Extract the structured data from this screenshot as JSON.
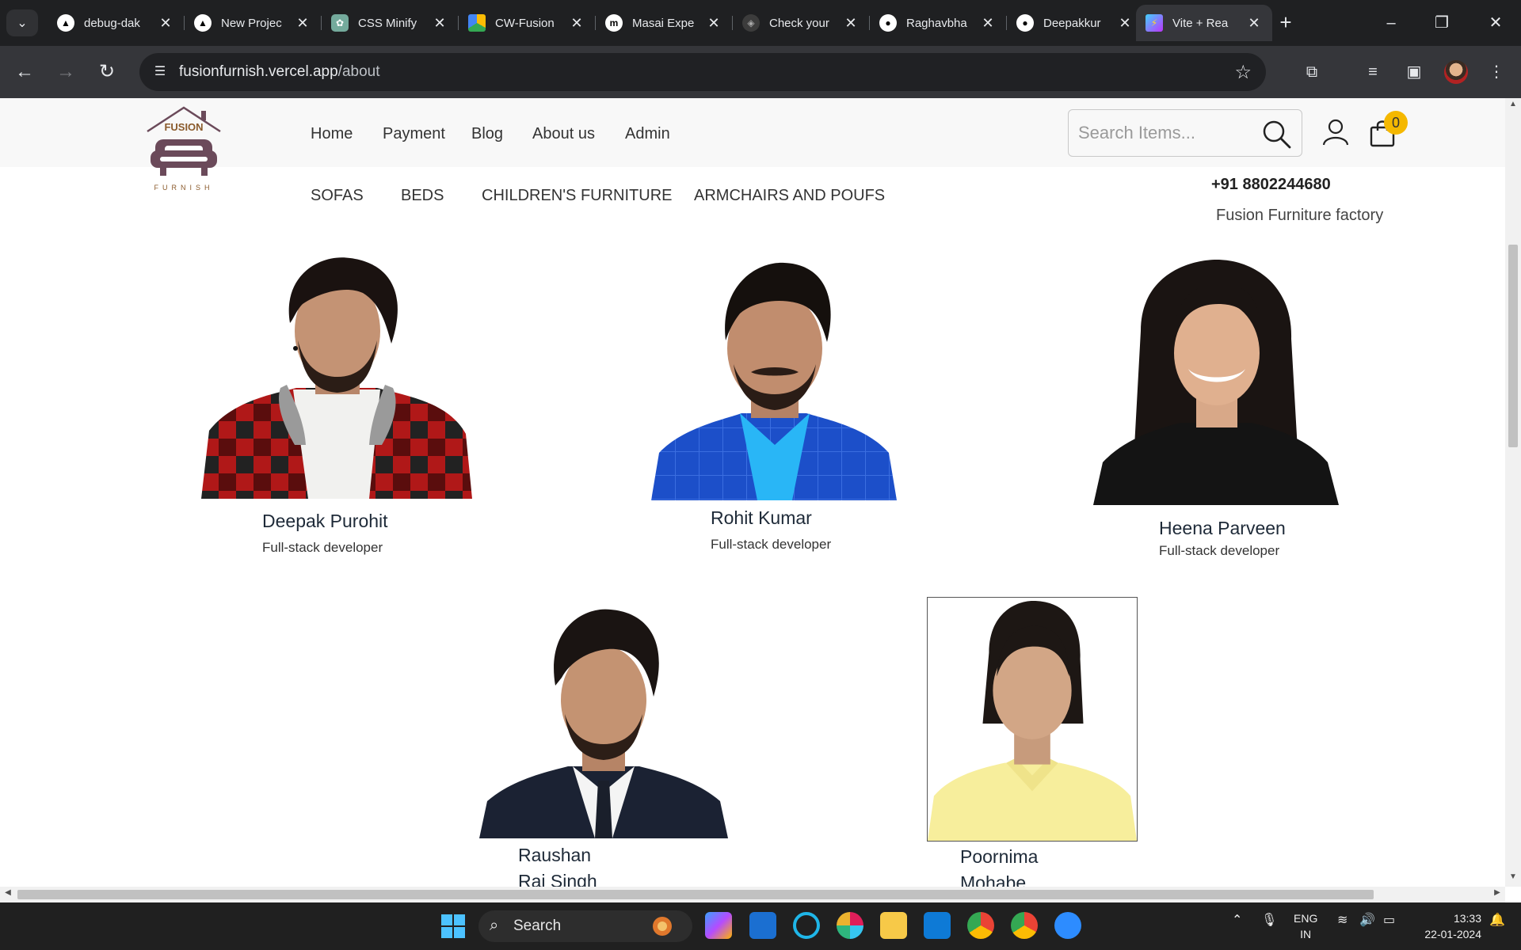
{
  "browser": {
    "tabs": [
      {
        "title": "debug-dak",
        "icon": "vercel-icon"
      },
      {
        "title": "New Projec",
        "icon": "vercel-icon"
      },
      {
        "title": "CSS Minify",
        "icon": "chatgpt-icon"
      },
      {
        "title": "CW-Fusion",
        "icon": "google-drive-icon"
      },
      {
        "title": "Masai Expe",
        "icon": "masai-icon"
      },
      {
        "title": "Check your",
        "icon": "link-icon"
      },
      {
        "title": "Raghavbha",
        "icon": "github-icon"
      },
      {
        "title": "Deepakkur",
        "icon": "github-icon"
      },
      {
        "title": "Vite + Rea",
        "icon": "vite-icon"
      }
    ],
    "url_host": "fusionfurnish.vercel.app",
    "url_path": "/about"
  },
  "site": {
    "logo_text": "FUSION",
    "logo_subtext": "FURNISH",
    "nav": [
      "Home",
      "Payment",
      "Blog",
      "About us",
      "Admin"
    ],
    "search_placeholder": "Search Items...",
    "cart_count": "0",
    "categories": [
      "SOFAS",
      "BEDS",
      "CHILDREN'S FURNITURE",
      "ARMCHAIRS AND POUFS"
    ],
    "phone": "+91 8802244680",
    "factory": "Fusion Furniture factory"
  },
  "team": [
    {
      "name": "Deepak Purohit",
      "role": "Full-stack developer"
    },
    {
      "name": "Rohit Kumar",
      "role": "Full-stack developer"
    },
    {
      "name": "Heena Parveen",
      "role": "Full-stack developer"
    },
    {
      "name_line1": "Raushan",
      "name_line2": "Raj Singh"
    },
    {
      "name_line1": "Poornima",
      "name_line2": "Mohabe"
    }
  ],
  "taskbar": {
    "search_label": "Search",
    "lang_line1": "ENG",
    "lang_line2": "IN",
    "time": "13:33",
    "date": "22-01-2024"
  },
  "colors": {
    "accent_badge": "#f5b800",
    "logo": "#6b4a5a",
    "chrome_dark": "#1f2022"
  }
}
